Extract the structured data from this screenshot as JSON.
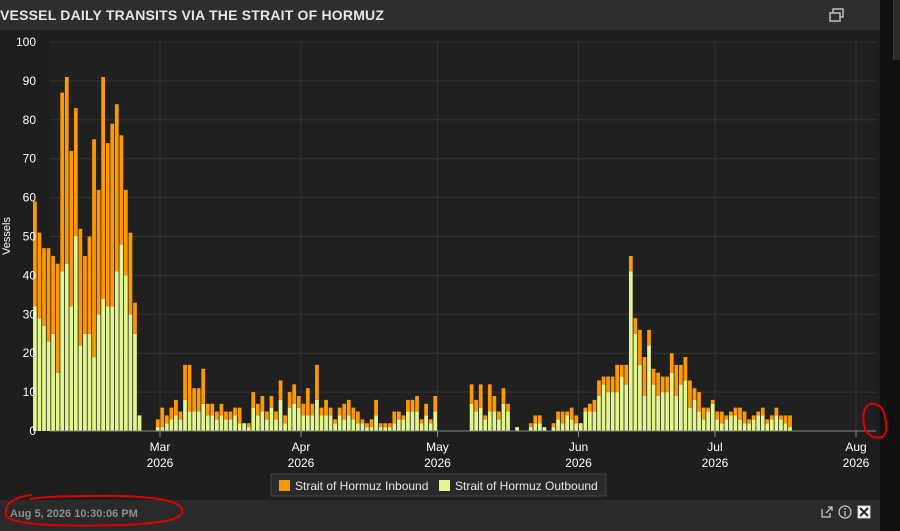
{
  "header": {
    "title": "VESSEL DAILY TRANSITS VIA THE STRAIT OF HORMUZ"
  },
  "footer": {
    "timestamp": "Aug 5, 2026 10:30:06 PM"
  },
  "icons": {
    "restore": "restore-window-icon",
    "external": "external-link-icon",
    "info": "info-icon",
    "export": "excel-export-icon"
  },
  "colors": {
    "inbound": "#ff9900",
    "outbound": "#e2f58e",
    "background": "#1e1e1e",
    "annotation": "#e00000"
  },
  "chart_data": {
    "type": "bar",
    "stacked": true,
    "title": "VESSEL DAILY TRANSITS VIA THE STRAIT OF HORMUZ",
    "ylabel": "Vessels",
    "xlabel": "",
    "ylim": [
      0,
      100
    ],
    "yticks": [
      0,
      10,
      20,
      30,
      40,
      50,
      60,
      70,
      80,
      90,
      100
    ],
    "xticks": [
      {
        "date": "2026-03-01",
        "label": "Mar",
        "year": "2026"
      },
      {
        "date": "2026-04-01",
        "label": "Apr",
        "year": "2026"
      },
      {
        "date": "2026-05-01",
        "label": "May",
        "year": "2026"
      },
      {
        "date": "2026-06-01",
        "label": "Jun",
        "year": "2026"
      },
      {
        "date": "2026-07-01",
        "label": "Jul",
        "year": "2026"
      },
      {
        "date": "2026-08-01",
        "label": "Aug",
        "year": "2026"
      }
    ],
    "x_start": "2026-02-01",
    "grid": true,
    "legend_position": "bottom",
    "series": [
      {
        "name": "Strait of Hormuz Inbound",
        "color": "#ff9900",
        "values": [
          27,
          22,
          20,
          24,
          20,
          28,
          46,
          48,
          40,
          33,
          30,
          20,
          25,
          56,
          32,
          57,
          42,
          47,
          43,
          28,
          22,
          21,
          8,
          0,
          0,
          0,
          0,
          2,
          5,
          2,
          3,
          4,
          2,
          9,
          12,
          6,
          6,
          9,
          3,
          3,
          2,
          3,
          2,
          2,
          2,
          4,
          0,
          1,
          4,
          3,
          4,
          2,
          3,
          2,
          5,
          2,
          4,
          5,
          3,
          3,
          7,
          3,
          9,
          2,
          4,
          2,
          1,
          2,
          4,
          4,
          3,
          3,
          1,
          1,
          2,
          4,
          1,
          1,
          1,
          3,
          2,
          1,
          3,
          3,
          4,
          1,
          3,
          1,
          4,
          0,
          0,
          0,
          0,
          0,
          0,
          0,
          5,
          3,
          6,
          1,
          7,
          4,
          2,
          4,
          2,
          0,
          0,
          0,
          0,
          1,
          2,
          2,
          0,
          0,
          1,
          2,
          3,
          1,
          3,
          2,
          0,
          1,
          2,
          3,
          4,
          2,
          4,
          4,
          7,
          3,
          5,
          4,
          4,
          9,
          10,
          4,
          4,
          6,
          4,
          4,
          5,
          8,
          5,
          6,
          7,
          3,
          5,
          3,
          1,
          1,
          2,
          3,
          1,
          1,
          2,
          3,
          3,
          1,
          1,
          1,
          2,
          1,
          1,
          2,
          1,
          2,
          3
        ]
      },
      {
        "name": "Strait of Hormuz Outbound",
        "color": "#e2f58e",
        "values": [
          32,
          29,
          27,
          23,
          25,
          15,
          41,
          43,
          32,
          50,
          22,
          25,
          25,
          19,
          30,
          34,
          32,
          32,
          41,
          48,
          40,
          30,
          25,
          4,
          0,
          0,
          0,
          1,
          1,
          2,
          3,
          4,
          3,
          8,
          5,
          5,
          5,
          7,
          4,
          4,
          3,
          4,
          3,
          3,
          4,
          2,
          2,
          1,
          6,
          4,
          5,
          3,
          6,
          3,
          8,
          2,
          6,
          7,
          6,
          4,
          4,
          4,
          8,
          4,
          4,
          4,
          2,
          4,
          3,
          4,
          3,
          2,
          2,
          1,
          1,
          4,
          1,
          1,
          1,
          2,
          3,
          3,
          5,
          5,
          5,
          2,
          4,
          2,
          5,
          0,
          0,
          0,
          0,
          0,
          0,
          0,
          7,
          5,
          6,
          3,
          5,
          5,
          3,
          7,
          5,
          0,
          1,
          0,
          0,
          1,
          2,
          2,
          1,
          0,
          1,
          3,
          2,
          4,
          3,
          2,
          2,
          5,
          5,
          5,
          9,
          12,
          10,
          10,
          10,
          14,
          12,
          41,
          25,
          17,
          9,
          22,
          12,
          9,
          10,
          10,
          15,
          9,
          12,
          13,
          6,
          8,
          5,
          3,
          5,
          7,
          3,
          2,
          3,
          4,
          4,
          3,
          2,
          2,
          3,
          4,
          4,
          2,
          3,
          4,
          3,
          2,
          1
        ]
      }
    ]
  }
}
